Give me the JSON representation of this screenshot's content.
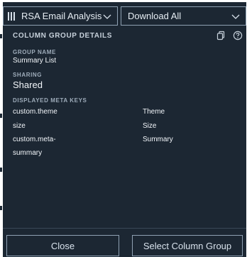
{
  "toolbar": {
    "report_label": "RSA Email Analysis",
    "download_label": "Download All"
  },
  "panel": {
    "title": "COLUMN GROUP DETAILS",
    "group_name_label": "GROUP NAME",
    "group_name_value": "Summary List",
    "sharing_label": "SHARING",
    "sharing_value": "Shared",
    "meta_keys_label": "DISPLAYED META KEYS",
    "meta_keys": [
      {
        "key": "custom.theme",
        "name": "Theme"
      },
      {
        "key": "size",
        "name": "Size"
      },
      {
        "key": "custom.meta-",
        "name": "Summary"
      },
      {
        "key": "summary",
        "name": ""
      }
    ]
  },
  "footer": {
    "close_label": "Close",
    "select_label": "Select Column Group"
  },
  "icons": {
    "grid": "grid-icon",
    "chevron": "chevron-down-icon",
    "copy": "copy-icon",
    "help": "help-icon"
  },
  "colors": {
    "panel_bg": "#1c2733",
    "border": "#8fa1b3",
    "text": "#e6edf3"
  }
}
